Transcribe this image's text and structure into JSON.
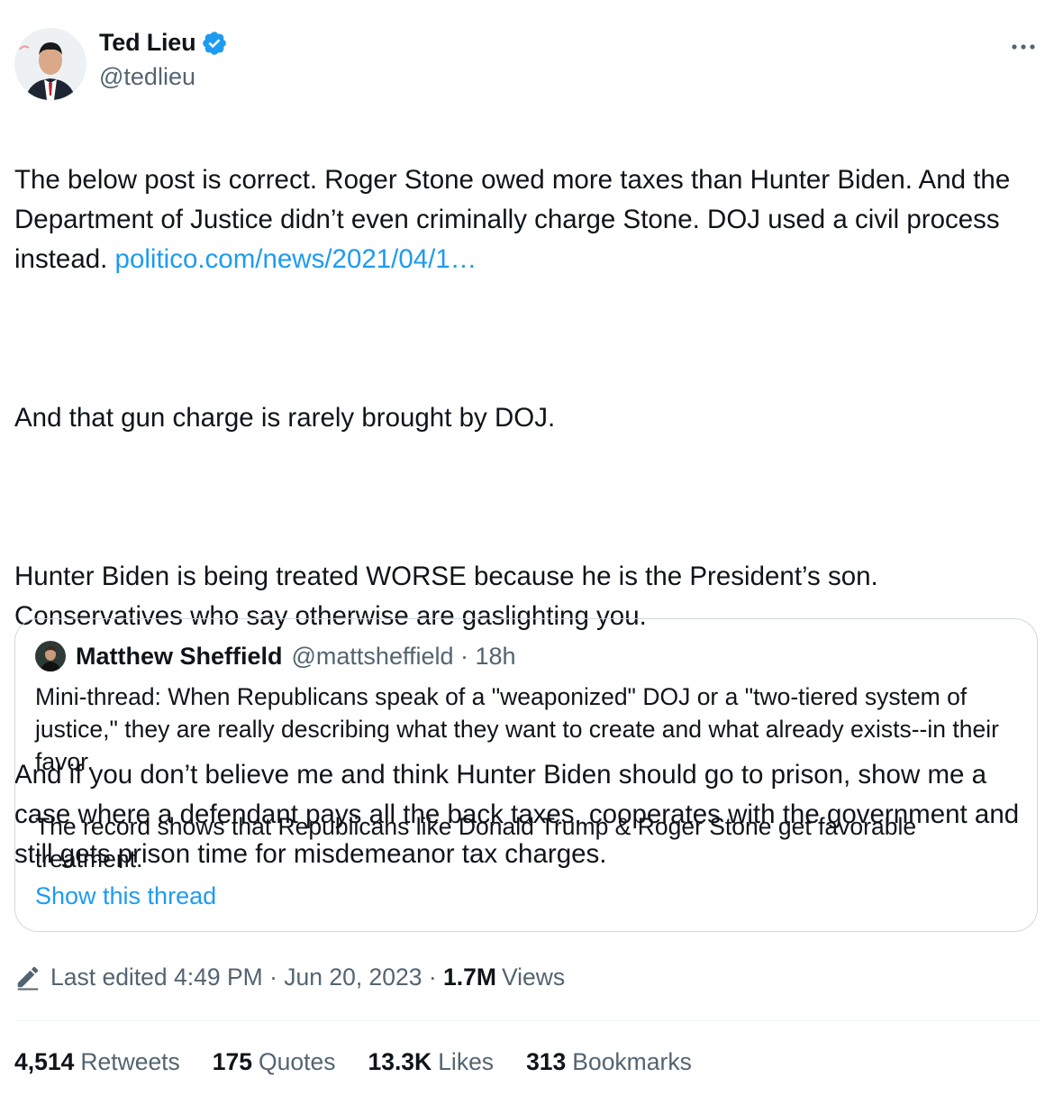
{
  "author": {
    "name": "Ted Lieu",
    "handle": "@tedlieu",
    "verified_color": "#1d9bf0"
  },
  "tweet": {
    "p1_text": "The below post is correct. Roger Stone owed more taxes than Hunter Biden. And the Department of Justice didn’t even criminally charge Stone. DOJ used a civil process instead. ",
    "p1_link": "politico.com/news/2021/04/1…",
    "p2": "And that gun charge is rarely brought by DOJ.",
    "p3": "Hunter Biden is being treated WORSE because he is the President’s son. Conservatives who say otherwise are gaslighting you.",
    "p4": "And if you don’t believe me and think Hunter Biden should go to prison, show me a case where a defendant pays all the back taxes, cooperates with the government and still gets prison time for misdemeanor tax charges."
  },
  "quote": {
    "name": "Matthew Sheffield",
    "handle": "@mattsheffield · 18h",
    "p1": "Mini-thread: When Republicans speak of a \"weaponized\" DOJ or a \"two-tiered system of justice,\" they are really describing what they want to create and what already exists--in their favor.",
    "p2": "The record shows that Republicans like Donald Trump & Roger Stone get favorable treatment.",
    "show_thread": "Show this thread"
  },
  "meta": {
    "edited": "Last edited 4:49 PM · Jun 20, 2023 · ",
    "views_count": "1.7M",
    "views_label": "Views"
  },
  "stats": [
    {
      "count": "4,514",
      "label": "Retweets"
    },
    {
      "count": "175",
      "label": "Quotes"
    },
    {
      "count": "13.3K",
      "label": "Likes"
    },
    {
      "count": "313",
      "label": "Bookmarks"
    }
  ],
  "colors": {
    "accent": "#1d9bf0",
    "secondary_text": "#536471",
    "border": "#cfd9de"
  },
  "icons": {
    "verified": "verified-badge-icon",
    "more": "more-options-icon",
    "edit": "edit-pencil-icon"
  }
}
